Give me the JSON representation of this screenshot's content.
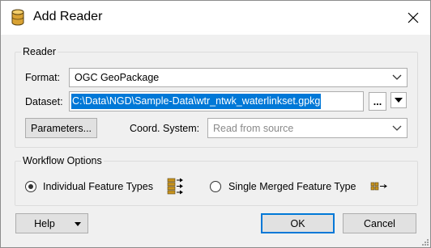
{
  "window": {
    "title": "Add Reader",
    "app_icon": "database-cylinder-icon",
    "close_icon": "close-icon"
  },
  "reader": {
    "group_label": "Reader",
    "format_label": "Format:",
    "format_value": "OGC GeoPackage",
    "dataset_label": "Dataset:",
    "dataset_value": "C:\\Data\\NGD\\Sample-Data\\wtr_ntwk_waterlinkset.gpkg",
    "browse_label": "...",
    "parameters_label": "Parameters...",
    "coord_system_label": "Coord. System:",
    "coord_system_value": "Read from source"
  },
  "workflow": {
    "group_label": "Workflow Options",
    "option_individual": "Individual Feature Types",
    "option_merged": "Single Merged Feature Type",
    "selected": "individual"
  },
  "buttons": {
    "help": "Help",
    "ok": "OK",
    "cancel": "Cancel"
  },
  "colors": {
    "selection": "#0078d7",
    "icon_gold": "#c8941e"
  }
}
